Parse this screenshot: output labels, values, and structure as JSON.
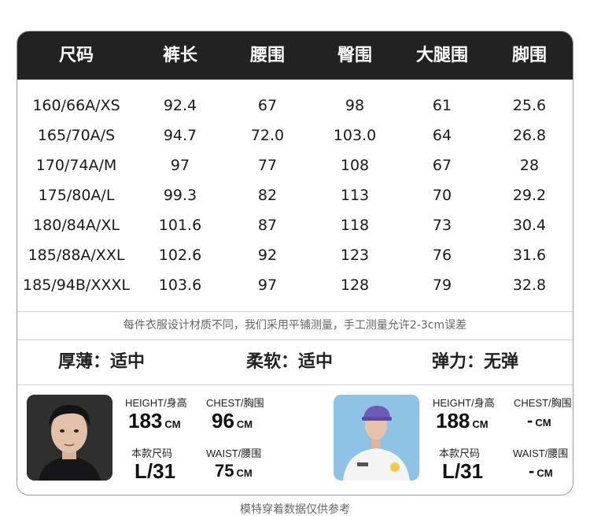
{
  "table": {
    "headers": [
      "尺码",
      "裤长",
      "腰围",
      "臀围",
      "大腿围",
      "脚围"
    ],
    "rows": [
      [
        "160/66A/XS",
        "92.4",
        "67",
        "98",
        "61",
        "25.6"
      ],
      [
        "165/70A/S",
        "94.7",
        "72.0",
        "103.0",
        "64",
        "26.8"
      ],
      [
        "170/74A/M",
        "97",
        "77",
        "108",
        "67",
        "28"
      ],
      [
        "175/80A/L",
        "99.3",
        "82",
        "113",
        "70",
        "29.2"
      ],
      [
        "180/84A/XL",
        "101.6",
        "87",
        "118",
        "73",
        "30.4"
      ],
      [
        "185/88A/XXL",
        "102.6",
        "92",
        "123",
        "76",
        "31.6"
      ],
      [
        "185/94B/XXXL",
        "103.6",
        "97",
        "128",
        "79",
        "32.8"
      ]
    ],
    "note": "每件衣服设计材质不同，我们采用平铺测量，手工测量允许2-3cm误差"
  },
  "fabric": {
    "thickness": "厚薄：适中",
    "softness": "柔软：适中",
    "elasticity": "弹力：无弹"
  },
  "models": [
    {
      "height_label": "HEIGHT/身高",
      "height_value": "183",
      "chest_label": "CHEST/胸围",
      "chest_value": "96",
      "size_label": "本款尺码",
      "size_value": "L/31",
      "waist_label": "WAIST/腰围",
      "waist_value": "75",
      "unit": "CM"
    },
    {
      "height_label": "HEIGHT/身高",
      "height_value": "188",
      "chest_label": "CHEST/胸围",
      "chest_value": "-",
      "size_label": "本款尺码",
      "size_value": "L/31",
      "waist_label": "WAIST/腰围",
      "waist_value": "-",
      "unit": "CM"
    }
  ],
  "footer": "模特穿着数据仅供参考",
  "colors": {
    "header_bg": "#222222",
    "header_text": "#ffffff",
    "note_text": "#666666",
    "border": "#9a9a9a"
  }
}
